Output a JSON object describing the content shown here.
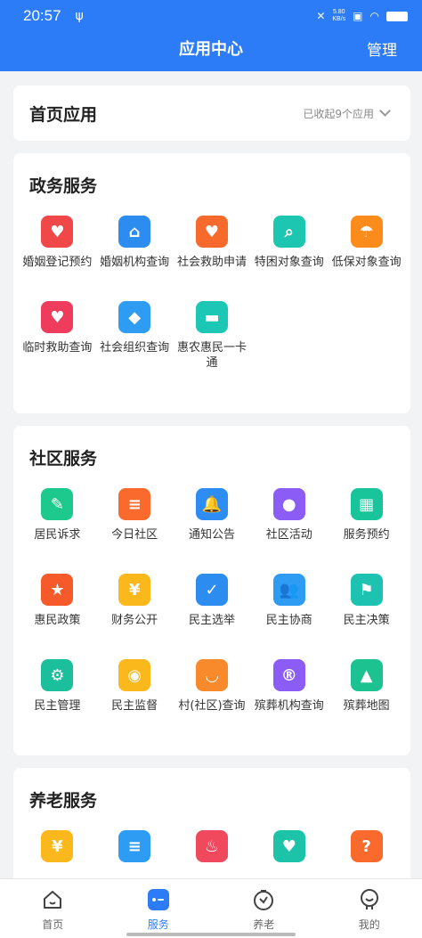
{
  "status": {
    "time": "20:57",
    "usb": "ψ",
    "speed_top": "5.80",
    "speed_bottom": "KB/s"
  },
  "header": {
    "title": "应用中心",
    "manage": "管理"
  },
  "home_apps": {
    "title": "首页应用",
    "collapsed_text": "已收起9个应用"
  },
  "sections": [
    {
      "title": "政务服务",
      "apps": [
        {
          "label": "婚姻登记预约",
          "icon": "marriage-register-icon",
          "color": "#f04848",
          "glyph": "♥"
        },
        {
          "label": "婚姻机构查询",
          "icon": "marriage-house-icon",
          "color": "#2d8cf0",
          "glyph": "⌂"
        },
        {
          "label": "社会救助申请",
          "icon": "wallet-icon",
          "color": "#f86a2b",
          "glyph": "♥"
        },
        {
          "label": "特困对象查询",
          "icon": "search-house-icon",
          "color": "#1dc6b0",
          "glyph": "⌕"
        },
        {
          "label": "低保对象查询",
          "icon": "umbrella-icon",
          "color": "#fb8c1c",
          "glyph": "☂"
        },
        {
          "label": "临时救助查询",
          "icon": "heart-hand-icon",
          "color": "#ef3c5c",
          "glyph": "♥"
        },
        {
          "label": "社会组织查询",
          "icon": "shapes-icon",
          "color": "#2e9cf3",
          "glyph": "◆"
        },
        {
          "label": "惠农惠民一卡通",
          "icon": "card-icon",
          "color": "#1cc7b6",
          "glyph": "▬"
        }
      ]
    },
    {
      "title": "社区服务",
      "apps": [
        {
          "label": "居民诉求",
          "icon": "edit-note-icon",
          "color": "#1dc98d",
          "glyph": "✎"
        },
        {
          "label": "今日社区",
          "icon": "news-icon",
          "color": "#f96a2c",
          "glyph": "≡"
        },
        {
          "label": "通知公告",
          "icon": "bell-icon",
          "color": "#2e8cf5",
          "glyph": "🔔"
        },
        {
          "label": "社区活动",
          "icon": "location-pin-icon",
          "color": "#8b5cf6",
          "glyph": "●"
        },
        {
          "label": "服务预约",
          "icon": "calendar-icon",
          "color": "#18c49a",
          "glyph": "▦"
        },
        {
          "label": "惠民政策",
          "icon": "policy-icon",
          "color": "#f65a2a",
          "glyph": "★"
        },
        {
          "label": "财务公开",
          "icon": "money-bag-icon",
          "color": "#fbb81c",
          "glyph": "¥"
        },
        {
          "label": "民主选举",
          "icon": "vote-box-icon",
          "color": "#2d8cf0",
          "glyph": "✓"
        },
        {
          "label": "民主协商",
          "icon": "people-icon",
          "color": "#2e9cf3",
          "glyph": "👥"
        },
        {
          "label": "民主决策",
          "icon": "decision-icon",
          "color": "#1dc3b0",
          "glyph": "⚑"
        },
        {
          "label": "民主管理",
          "icon": "management-icon",
          "color": "#1bbf9c",
          "glyph": "⚙"
        },
        {
          "label": "民主监督",
          "icon": "supervision-icon",
          "color": "#fbb81c",
          "glyph": "◉"
        },
        {
          "label": "村(社区)查询",
          "icon": "chat-bubble-icon",
          "color": "#f98a2c",
          "glyph": "◡"
        },
        {
          "label": "殡葬机构查询",
          "icon": "registered-icon",
          "color": "#8b5cf6",
          "glyph": "®"
        },
        {
          "label": "殡葬地图",
          "icon": "map-icon",
          "color": "#1cc28f",
          "glyph": "▲"
        }
      ]
    },
    {
      "title": "养老服务",
      "apps": [
        {
          "label": "",
          "icon": "coupon-icon",
          "color": "#fbb81c",
          "glyph": "¥"
        },
        {
          "label": "",
          "icon": "document-icon",
          "color": "#2e9cf3",
          "glyph": "≡"
        },
        {
          "label": "",
          "icon": "flame-icon",
          "color": "#f0485c",
          "glyph": "♨"
        },
        {
          "label": "",
          "icon": "map-heart-icon",
          "color": "#1dc3a8",
          "glyph": "♥"
        },
        {
          "label": "",
          "icon": "question-icon",
          "color": "#f96a2c",
          "glyph": "?"
        }
      ]
    }
  ],
  "tabs": [
    {
      "label": "首页",
      "icon": "home-tab-icon",
      "active": false
    },
    {
      "label": "服务",
      "icon": "service-tab-icon",
      "active": true
    },
    {
      "label": "养老",
      "icon": "elderly-tab-icon",
      "active": false
    },
    {
      "label": "我的",
      "icon": "profile-tab-icon",
      "active": false
    }
  ]
}
